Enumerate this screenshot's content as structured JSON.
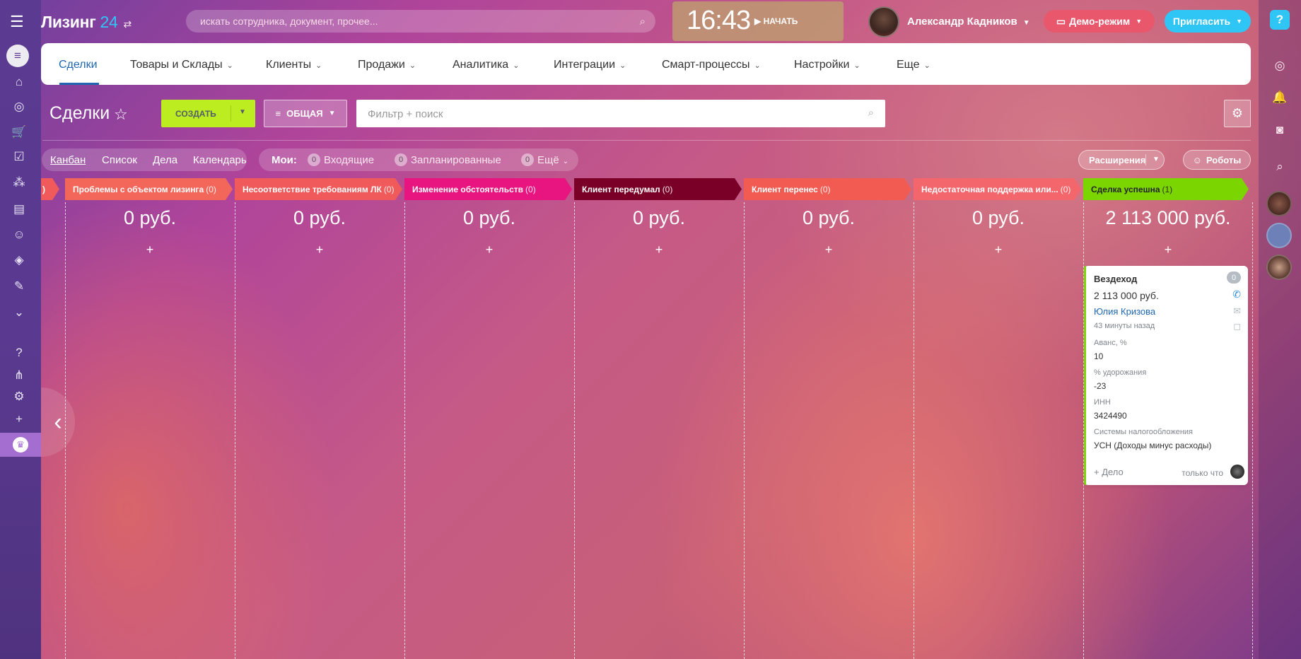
{
  "app": {
    "logo_name": "Лизинг",
    "logo_num": "24",
    "search_placeholder": "искать сотрудника, документ, прочее...",
    "clock_time": "16:43",
    "clock_start": "НАЧАТЬ",
    "user_name": "Александр Кадников",
    "demo_label": "Демо-режим",
    "invite_label": "Пригласить",
    "help_label": "?"
  },
  "nav": {
    "items": [
      "Сделки",
      "Товары и Склады",
      "Клиенты",
      "Продажи",
      "Аналитика",
      "Интеграции",
      "Смарт-процессы",
      "Настройки",
      "Еще"
    ]
  },
  "toolbar": {
    "title": "Сделки",
    "create_label": "СОЗДАТЬ",
    "filter_label": "ОБЩАЯ",
    "filter_placeholder": "Фильтр + поиск"
  },
  "views": {
    "tabs": [
      "Канбан",
      "Список",
      "Дела",
      "Календарь"
    ],
    "mine_label": "Мои:",
    "incoming_count": "0",
    "incoming_label": "Входящие",
    "planned_count": "0",
    "planned_label": "Запланированные",
    "more_count": "0",
    "more_label": "Ещё",
    "extensions_label": "Расширения",
    "robots_label": "Роботы"
  },
  "columns": [
    {
      "title": "Проблемы с объектом лизинга",
      "count": "(0)",
      "sum": "0 руб.",
      "color": "#f3665a"
    },
    {
      "title": "Несоответствие требованиям ЛК",
      "count": "(0)",
      "sum": "0 руб.",
      "color": "#f05a5a"
    },
    {
      "title": "Изменение обстоятельств",
      "count": "(0)",
      "sum": "0 руб.",
      "color": "#e8147f"
    },
    {
      "title": "Клиент передумал",
      "count": "(0)",
      "sum": "0 руб.",
      "color": "#7a0027"
    },
    {
      "title": "Клиент перенес",
      "count": "(0)",
      "sum": "0 руб.",
      "color": "#f25b52"
    },
    {
      "title": "Недостаточная поддержка или...",
      "count": "(0)",
      "sum": "0 руб.",
      "color": "#f3666c"
    },
    {
      "title": "Сделка успешна",
      "count": "(1)",
      "sum": "2 113 000 руб.",
      "color": "#7bd500"
    }
  ],
  "card": {
    "title": "Вездеход",
    "badge": "0",
    "amount": "2 113 000 руб.",
    "contact": "Юлия Кризова",
    "ago": "43 минуты назад",
    "fields": [
      {
        "label": "Аванс, %",
        "value": "10"
      },
      {
        "label": "% удорожания",
        "value": "-23"
      },
      {
        "label": "ИНН",
        "value": "3424490"
      },
      {
        "label": "Системы налогообложения",
        "value": "УСН (Доходы минус расходы)"
      }
    ],
    "add_activity": "+ Дело",
    "when": "только что"
  }
}
